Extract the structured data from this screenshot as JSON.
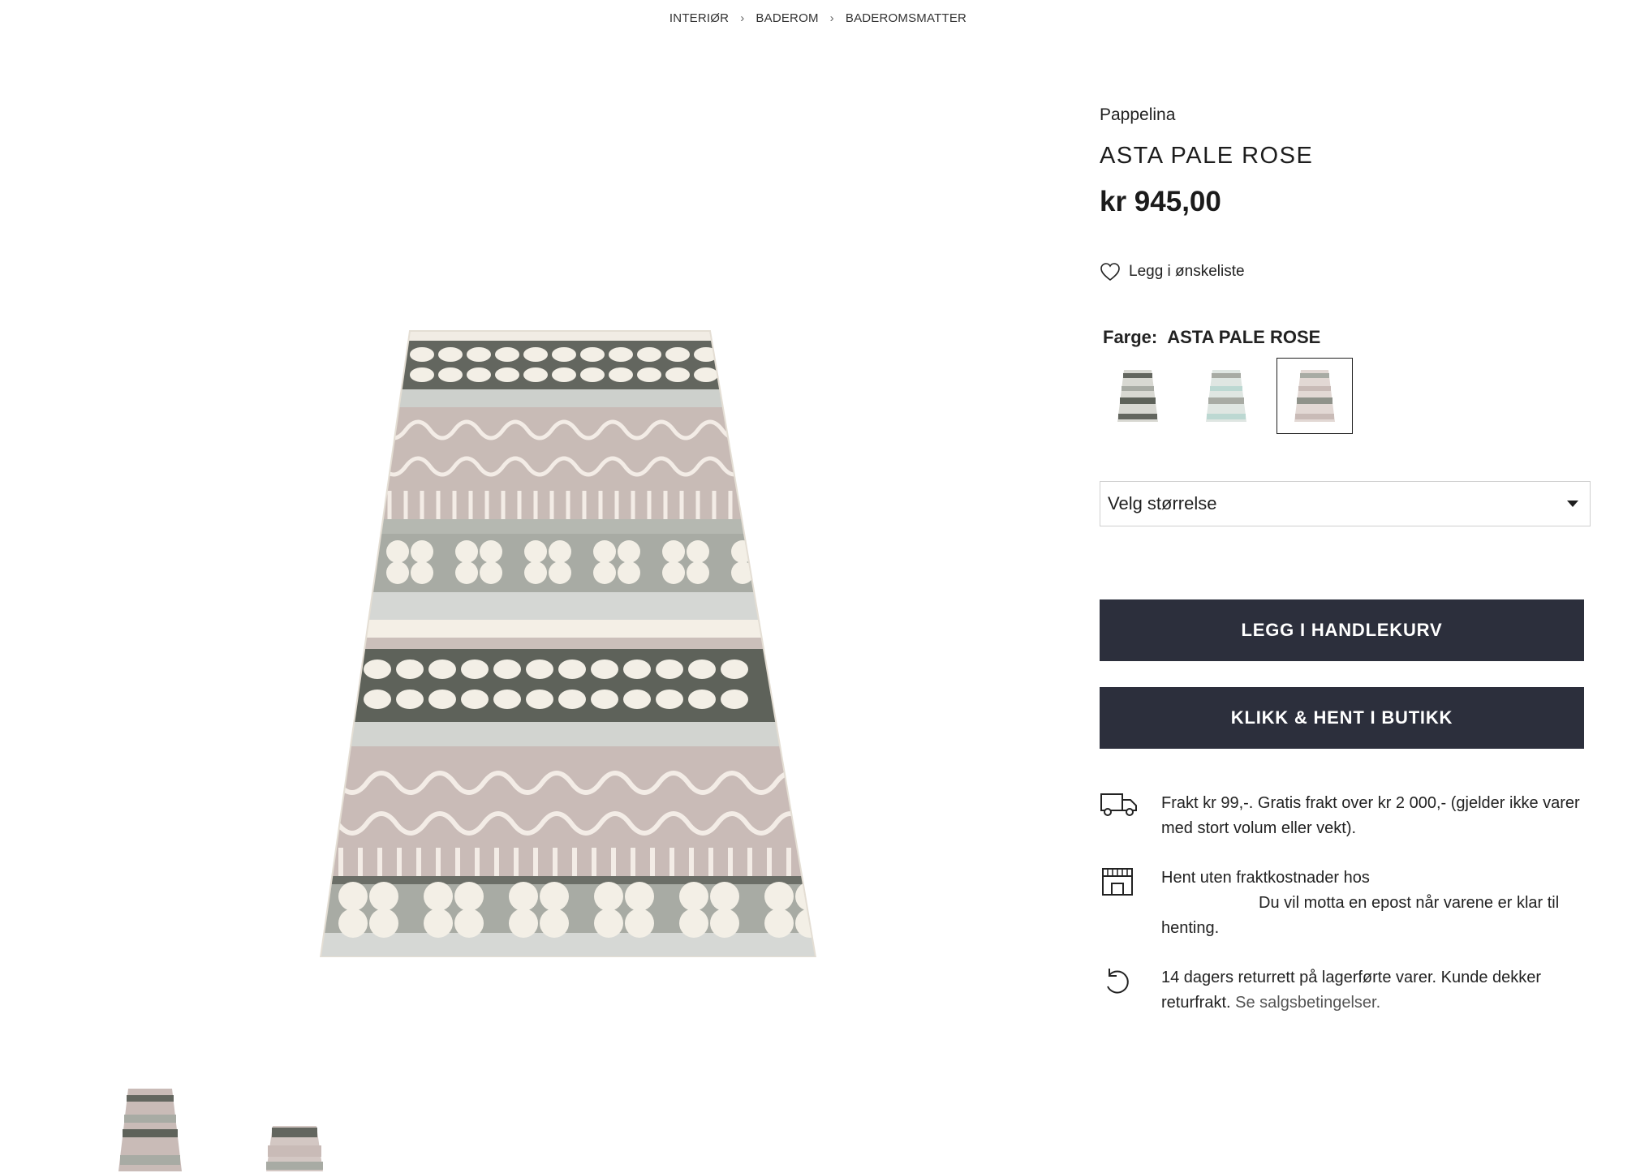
{
  "breadcrumb": [
    {
      "label": "INTERIØR"
    },
    {
      "label": "BADEROM"
    },
    {
      "label": "BADEROMSMATTER"
    }
  ],
  "product": {
    "brand": "Pappelina",
    "title": "ASTA PALE ROSE",
    "price": "kr 945,00",
    "wishlist_label": "Legg i ønskeliste",
    "color_label": "Farge:",
    "color_value": "ASTA PALE ROSE",
    "swatches": [
      {
        "icon": "rug-grey-swatch",
        "selected": false
      },
      {
        "icon": "rug-mint-swatch",
        "selected": false
      },
      {
        "icon": "rug-rose-swatch",
        "selected": true
      }
    ],
    "size_select": {
      "placeholder": "Velg størrelse"
    },
    "add_to_cart": "LEGG I HANDLEKURV",
    "click_collect": "KLIKK & HENT I BUTIKK"
  },
  "perks": {
    "shipping": {
      "icon": "truck-icon",
      "text": "Frakt kr 99,-. Gratis frakt over kr 2 000,- (gjelder ikke varer med stort volum eller vekt)."
    },
    "pickup": {
      "icon": "store-icon",
      "text_1": "Hent uten fraktkostnader hos",
      "text_2": "Du vil motta en epost når varene er klar til henting."
    },
    "returns": {
      "icon": "return-arrow-icon",
      "text": "14 dagers returrett på lagerførte varer. Kunde dekker returfrakt.",
      "link": "Se salgsbetingelser."
    }
  },
  "colors": {
    "button_bg": "#2c2f3c",
    "rug_dark": "#5e625a",
    "rug_rose": "#c9bbb7",
    "rug_grey": "#a8aba4",
    "rug_cream": "#f4efe6"
  }
}
